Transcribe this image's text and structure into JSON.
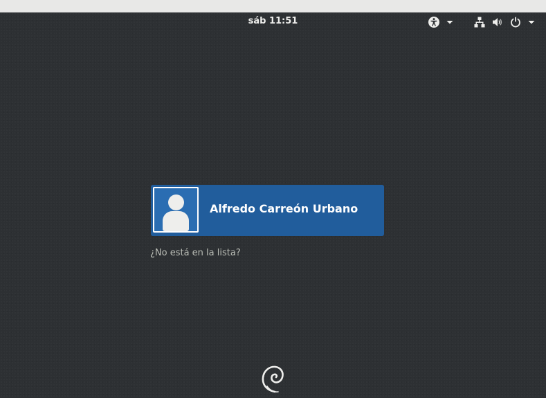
{
  "topbar": {
    "clock": "sáb 11:51",
    "icons": [
      "accessibility-icon",
      "network-wired-icon",
      "volume-icon",
      "power-icon"
    ]
  },
  "login": {
    "user_name": "Alfredo Carreón Urbano",
    "not_listed_label": "¿No está en la lista?"
  },
  "logo": "debian-swirl-logo",
  "colors": {
    "background": "#2d3033",
    "user_card": "#215d9c",
    "text": "#eeeeec",
    "muted_text": "#babdb6"
  }
}
